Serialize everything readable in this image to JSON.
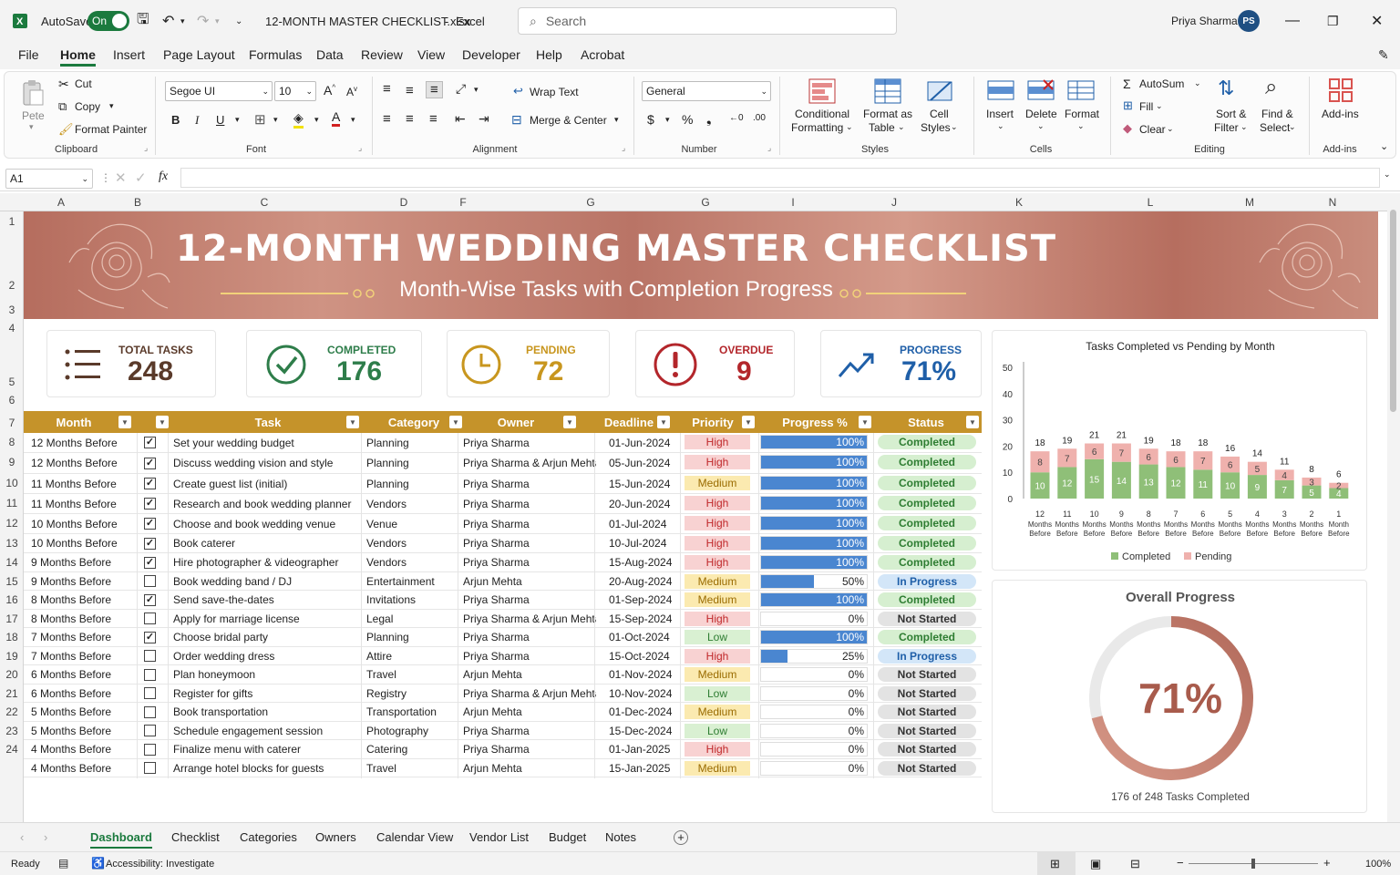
{
  "titlebar": {
    "autosave": "AutoSave",
    "toggle": "On",
    "filename": "12-MONTH MASTER CHECKLIST.xlsx",
    "sep": "-",
    "app": "Excel",
    "search_placeholder": "Search",
    "user": "Priya Sharma",
    "initials": "PS"
  },
  "menu": [
    "File",
    "Home",
    "Insert",
    "Page Layout",
    "Formulas",
    "Data",
    "Review",
    "View",
    "Developer",
    "Help",
    "Acrobat"
  ],
  "ribbon": {
    "paste": "Pete",
    "cut": "Cut",
    "copy": "Copy",
    "format_painter": "Format Painter",
    "clipboard": "Clipboard",
    "font_name": "Segoe UI",
    "font_size": "10",
    "font": "Font",
    "wrap": "Wrap Text",
    "merge": "Merge & Center",
    "alignment": "Alignment",
    "number_format": "General",
    "number": "Number",
    "cond1": "Conditional",
    "cond2": "Formatting",
    "fmt1": "Format as",
    "fmt2": "Table",
    "cs1": "Cell",
    "cs2": "Styles",
    "styles": "Styles",
    "insert": "Insert",
    "delete": "Delete",
    "format": "Format",
    "cells": "Cells",
    "autosum": "AutoSum",
    "fill": "Fill",
    "clear": "Clear",
    "sort1": "Sort &",
    "sort2": "Filter",
    "find1": "Find &",
    "find2": "Select",
    "editing": "Editing",
    "addins": "Add-ins",
    "addins_group": "Add-ins"
  },
  "formula_bar": {
    "cell_ref": "A1",
    "fx": "fx"
  },
  "columns": [
    "A",
    "B",
    "C",
    "D",
    "F",
    "G",
    "G",
    "I",
    "J",
    "K",
    "L",
    "M",
    "N"
  ],
  "rows": [
    "1",
    "2",
    "3",
    "4",
    "5",
    "6",
    "7",
    "8",
    "9",
    "10",
    "11",
    "12",
    "13",
    "14",
    "15",
    "16",
    "17",
    "18",
    "19",
    "20",
    "21",
    "22",
    "23",
    "24"
  ],
  "banner": {
    "title": "12-MONTH WEDDING MASTER CHECKLIST",
    "subtitle": "Month-Wise Tasks with Completion Progress"
  },
  "kpis": [
    {
      "label": "TOTAL TASKS",
      "value": "248",
      "color": "#5a3a2a",
      "icon": "list-icon"
    },
    {
      "label": "COMPLETED",
      "value": "176",
      "color": "#2e7d4a",
      "icon": "check-circle-icon"
    },
    {
      "label": "PENDING",
      "value": "72",
      "color": "#c8961e",
      "icon": "clock-icon"
    },
    {
      "label": "OVERDUE",
      "value": "9",
      "color": "#b3262b",
      "icon": "alert-icon"
    },
    {
      "label": "PROGRESS",
      "value": "71%",
      "color": "#1f5fa8",
      "icon": "trend-up-icon"
    }
  ],
  "table": {
    "headers": [
      "Month",
      "",
      "Task",
      "Category",
      "Owner",
      "Deadline",
      "Priority",
      "Progress %",
      "Status"
    ],
    "rows": [
      {
        "month": "12 Months Before",
        "done": true,
        "task": "Set your wedding budget",
        "category": "Planning",
        "owner": "Priya Sharma",
        "deadline": "01-Jun-2024",
        "priority": "High",
        "progress": 1,
        "progress_label": "100%",
        "status": "Completed"
      },
      {
        "month": "12 Months Before",
        "done": true,
        "task": "Discuss wedding vision and style",
        "category": "Planning",
        "owner": "Priya Sharma & Arjun Mehta",
        "deadline": "05-Jun-2024",
        "priority": "High",
        "progress": 1,
        "progress_label": "100%",
        "status": "Completed"
      },
      {
        "month": "11 Months Before",
        "done": true,
        "task": "Create guest list (initial)",
        "category": "Planning",
        "owner": "Priya Sharma",
        "deadline": "15-Jun-2024",
        "priority": "Medium",
        "progress": 1,
        "progress_label": "100%",
        "status": "Completed"
      },
      {
        "month": "11 Months Before",
        "done": true,
        "task": "Research and book wedding planner",
        "category": "Vendors",
        "owner": "Priya Sharma",
        "deadline": "20-Jun-2024",
        "priority": "High",
        "progress": 1,
        "progress_label": "100%",
        "status": "Completed"
      },
      {
        "month": "10 Months Before",
        "done": true,
        "task": "Choose and book wedding venue",
        "category": "Venue",
        "owner": "Priya Sharma",
        "deadline": "01-Jul-2024",
        "priority": "High",
        "progress": 1,
        "progress_label": "100%",
        "status": "Completed"
      },
      {
        "month": "10 Months Before",
        "done": true,
        "task": "Book caterer",
        "category": "Vendors",
        "owner": "Priya Sharma",
        "deadline": "10-Jul-2024",
        "priority": "High",
        "progress": 1,
        "progress_label": "100%",
        "status": "Completed"
      },
      {
        "month": "9 Months Before",
        "done": true,
        "task": "Hire photographer & videographer",
        "category": "Vendors",
        "owner": "Priya Sharma",
        "deadline": "15-Aug-2024",
        "priority": "High",
        "progress": 1,
        "progress_label": "100%",
        "status": "Completed"
      },
      {
        "month": "9 Months Before",
        "done": false,
        "task": "Book wedding band / DJ",
        "category": "Entertainment",
        "owner": "Arjun Mehta",
        "deadline": "20-Aug-2024",
        "priority": "Medium",
        "progress": 0.5,
        "progress_label": "50%",
        "status": "In Progress"
      },
      {
        "month": "8 Months Before",
        "done": true,
        "task": "Send save-the-dates",
        "category": "Invitations",
        "owner": "Priya Sharma",
        "deadline": "01-Sep-2024",
        "priority": "Medium",
        "progress": 1,
        "progress_label": "100%",
        "status": "Completed"
      },
      {
        "month": "8 Months Before",
        "done": false,
        "task": "Apply for marriage license",
        "category": "Legal",
        "owner": "Priya Sharma & Arjun Mehta",
        "deadline": "15-Sep-2024",
        "priority": "High",
        "progress": 0,
        "progress_label": "0%",
        "status": "Not Started"
      },
      {
        "month": "7 Months Before",
        "done": true,
        "task": "Choose bridal party",
        "category": "Planning",
        "owner": "Priya Sharma",
        "deadline": "01-Oct-2024",
        "priority": "Low",
        "progress": 1,
        "progress_label": "100%",
        "status": "Completed"
      },
      {
        "month": "7 Months Before",
        "done": false,
        "task": "Order wedding dress",
        "category": "Attire",
        "owner": "Priya Sharma",
        "deadline": "15-Oct-2024",
        "priority": "High",
        "progress": 0.25,
        "progress_label": "25%",
        "status": "In Progress"
      },
      {
        "month": "6 Months Before",
        "done": false,
        "task": "Plan honeymoon",
        "category": "Travel",
        "owner": "Arjun Mehta",
        "deadline": "01-Nov-2024",
        "priority": "Medium",
        "progress": 0,
        "progress_label": "0%",
        "status": "Not Started"
      },
      {
        "month": "6 Months Before",
        "done": false,
        "task": "Register for gifts",
        "category": "Registry",
        "owner": "Priya Sharma & Arjun Mehta",
        "deadline": "10-Nov-2024",
        "priority": "Low",
        "progress": 0,
        "progress_label": "0%",
        "status": "Not Started"
      },
      {
        "month": "5 Months Before",
        "done": false,
        "task": "Book transportation",
        "category": "Transportation",
        "owner": "Arjun Mehta",
        "deadline": "01-Dec-2024",
        "priority": "Medium",
        "progress": 0,
        "progress_label": "0%",
        "status": "Not Started"
      },
      {
        "month": "5 Months Before",
        "done": false,
        "task": "Schedule engagement session",
        "category": "Photography",
        "owner": "Priya Sharma",
        "deadline": "15-Dec-2024",
        "priority": "Low",
        "progress": 0,
        "progress_label": "0%",
        "status": "Not Started"
      },
      {
        "month": "4 Months Before",
        "done": false,
        "task": "Finalize menu with caterer",
        "category": "Catering",
        "owner": "Priya Sharma",
        "deadline": "01-Jan-2025",
        "priority": "High",
        "progress": 0,
        "progress_label": "0%",
        "status": "Not Started"
      },
      {
        "month": "4 Months Before",
        "done": false,
        "task": "Arrange hotel blocks for guests",
        "category": "Travel",
        "owner": "Arjun Mehta",
        "deadline": "15-Jan-2025",
        "priority": "Medium",
        "progress": 0,
        "progress_label": "0%",
        "status": "Not Started"
      }
    ]
  },
  "chart_data": {
    "type": "bar",
    "stacked": true,
    "title": "Tasks Completed vs Pending by Month",
    "categories": [
      "12 Months Before",
      "11 Months Before",
      "10 Months Before",
      "9 Months Before",
      "8 Months Before",
      "7 Months Before",
      "6 Months Before",
      "5 Months Before",
      "4 Months Before",
      "3 Months Before",
      "2 Months Before",
      "1 Month Before"
    ],
    "category_top": [
      "12",
      "11",
      "10",
      "9",
      "8",
      "7",
      "6",
      "5",
      "4",
      "3",
      "2",
      "1"
    ],
    "category_bottom": [
      "Months Before",
      "Months Before",
      "Months Before",
      "Months Before",
      "Months Before",
      "Months Before",
      "Months Before",
      "Months Before",
      "Months Before",
      "Months Before",
      "Months Before",
      "Month Before"
    ],
    "series": [
      {
        "name": "Completed",
        "color": "#8fbf78",
        "values": [
          10,
          12,
          15,
          14,
          13,
          12,
          11,
          10,
          9,
          7,
          5,
          4
        ]
      },
      {
        "name": "Pending",
        "color": "#efb1ad",
        "values": [
          8,
          7,
          6,
          7,
          6,
          6,
          7,
          6,
          5,
          4,
          3,
          2
        ]
      }
    ],
    "totals": [
      18,
      19,
      21,
      21,
      19,
      18,
      18,
      16,
      14,
      11,
      8,
      6
    ],
    "yticks": [
      "0",
      "10",
      "20",
      "30",
      "40",
      "50"
    ],
    "ylim": [
      0,
      50
    ],
    "legend": "bottom"
  },
  "progress": {
    "title": "Overall Progress",
    "value": 0.71,
    "label": "71%",
    "caption": "176 of 248 Tasks Completed"
  },
  "sheet_tabs": [
    "Dashboard",
    "Checklist",
    "Categories",
    "Owners",
    "Calendar View",
    "Vendor List",
    "Budget",
    "Notes"
  ],
  "statusbar": {
    "ready": "Ready",
    "accessibility": "Accessibility: Investigate",
    "zoom": "100%"
  },
  "colors": {
    "excel_green": "#1b7a3e",
    "gold_header": "#c5932a",
    "rose_banner": "#c08070",
    "bar_blue": "#4a86d0"
  }
}
